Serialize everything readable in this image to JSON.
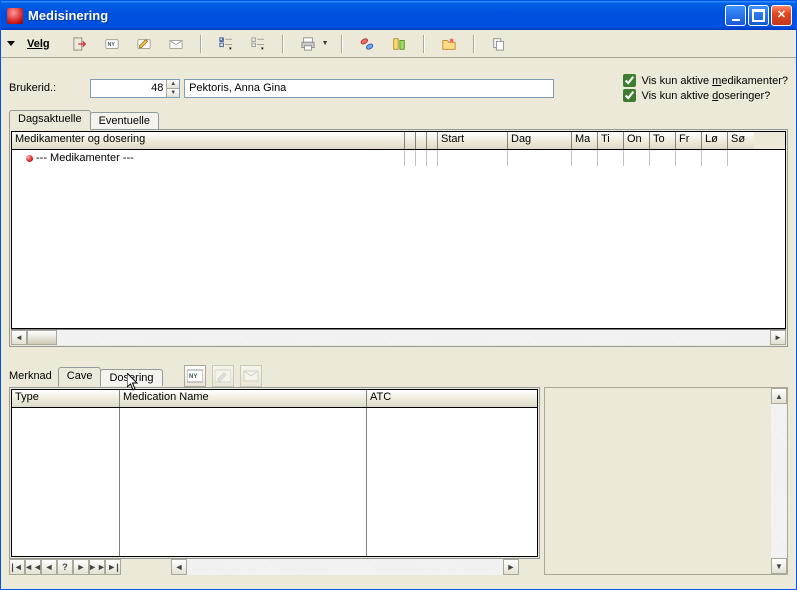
{
  "window": {
    "title": "Medisinering"
  },
  "menu": {
    "velg": "Velg"
  },
  "user": {
    "label": "Brukerid.:",
    "id": "48",
    "name": "Pektoris, Anna Gina"
  },
  "filters": {
    "aktive_med_label_pre": "Vis kun aktive ",
    "aktive_med_u": "m",
    "aktive_med_label_post": "edikamenter?",
    "aktive_dos_label_pre": "Vis kun aktive ",
    "aktive_dos_u": "d",
    "aktive_dos_label_post": "oseringer?",
    "aktive_med": true,
    "aktive_dos": true
  },
  "tabs_top": {
    "dagsaktuelle": "Dagsaktuelle",
    "eventuelle": "Eventuelle"
  },
  "grid_top": {
    "headers": {
      "med": "Medikamenter og dosering",
      "start": "Start",
      "dag": "Dag",
      "ma": "Ma",
      "ti": "Ti",
      "on": "On",
      "to": "To",
      "fr": "Fr",
      "lo": "Lø",
      "so": "Sø"
    },
    "row0": "--- Medikamenter ---"
  },
  "tabs_bottom": {
    "merknad": "Merknad",
    "cave": "Cave",
    "dosering": "Dosering"
  },
  "grid_bottom": {
    "headers": {
      "type": "Type",
      "medname": "Medication Name",
      "atc": "ATC"
    }
  },
  "nav": {
    "question": "?"
  },
  "icons": {
    "ny": "NY"
  }
}
